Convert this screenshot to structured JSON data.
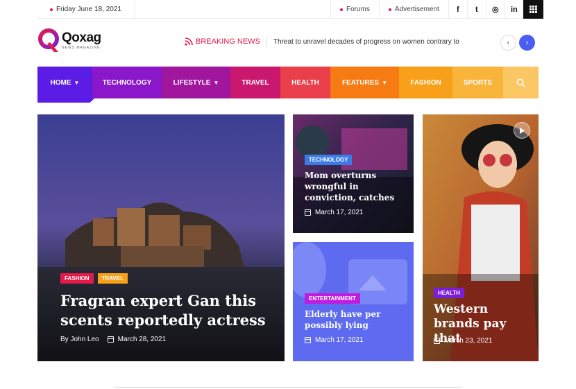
{
  "topbar": {
    "date": "Friday June 18, 2021",
    "links": [
      "Forums",
      "Advertisement"
    ],
    "social_icons": [
      "facebook-icon",
      "twitter-icon",
      "instagram-icon",
      "linkedin-icon"
    ],
    "social_glyphs": [
      "f",
      "t",
      "◎",
      "in"
    ]
  },
  "logo": {
    "name": "Qoxag",
    "tagline": "NEWS MAGAZINE"
  },
  "breaking": {
    "label": "BREAKING NEWS",
    "headline": "Threat to unravel decades of progress on women contrary to"
  },
  "menu": [
    {
      "label": "HOME",
      "dropdown": true,
      "color": "#5b1de6"
    },
    {
      "label": "TECHNOLOGY",
      "dropdown": false,
      "color": "#8a17c9"
    },
    {
      "label": "LIFESTYLE",
      "dropdown": true,
      "color": "#a0179e"
    },
    {
      "label": "TRAVEL",
      "dropdown": false,
      "color": "#c9186e"
    },
    {
      "label": "HEALTH",
      "dropdown": false,
      "color": "#ea3f4a"
    },
    {
      "label": "FEATURES",
      "dropdown": true,
      "color": "#f67b12"
    },
    {
      "label": "FASHION",
      "dropdown": false,
      "color": "#f8a01a"
    },
    {
      "label": "SPORTS",
      "dropdown": false,
      "color": "#f9b43b"
    }
  ],
  "search_color": "#fbc765",
  "featured": {
    "tags": [
      {
        "label": "FASHION",
        "color": "#e6194b"
      },
      {
        "label": "TRAVEL",
        "color": "#f8a01a"
      }
    ],
    "headline": "Fragran expert Gan this scents reportedly actress",
    "author": "By John Leo",
    "date": "March 28, 2021"
  },
  "story_tech": {
    "tag": "TECHNOLOGY",
    "tag_color": "#3a7be8",
    "headline": "Mom overturns wrongful in conviction, catches",
    "date": "March 17, 2021"
  },
  "story_ent": {
    "tag": "ENTERTAINMENT",
    "tag_color": "#c21be0",
    "headline": "Elderly have per possibly lying",
    "date": "March 17, 2021"
  },
  "story_health": {
    "tag": "HEALTH",
    "tag_color": "#7a1fd6",
    "headline": "Western brands pay that",
    "date": "March 23, 2021"
  }
}
